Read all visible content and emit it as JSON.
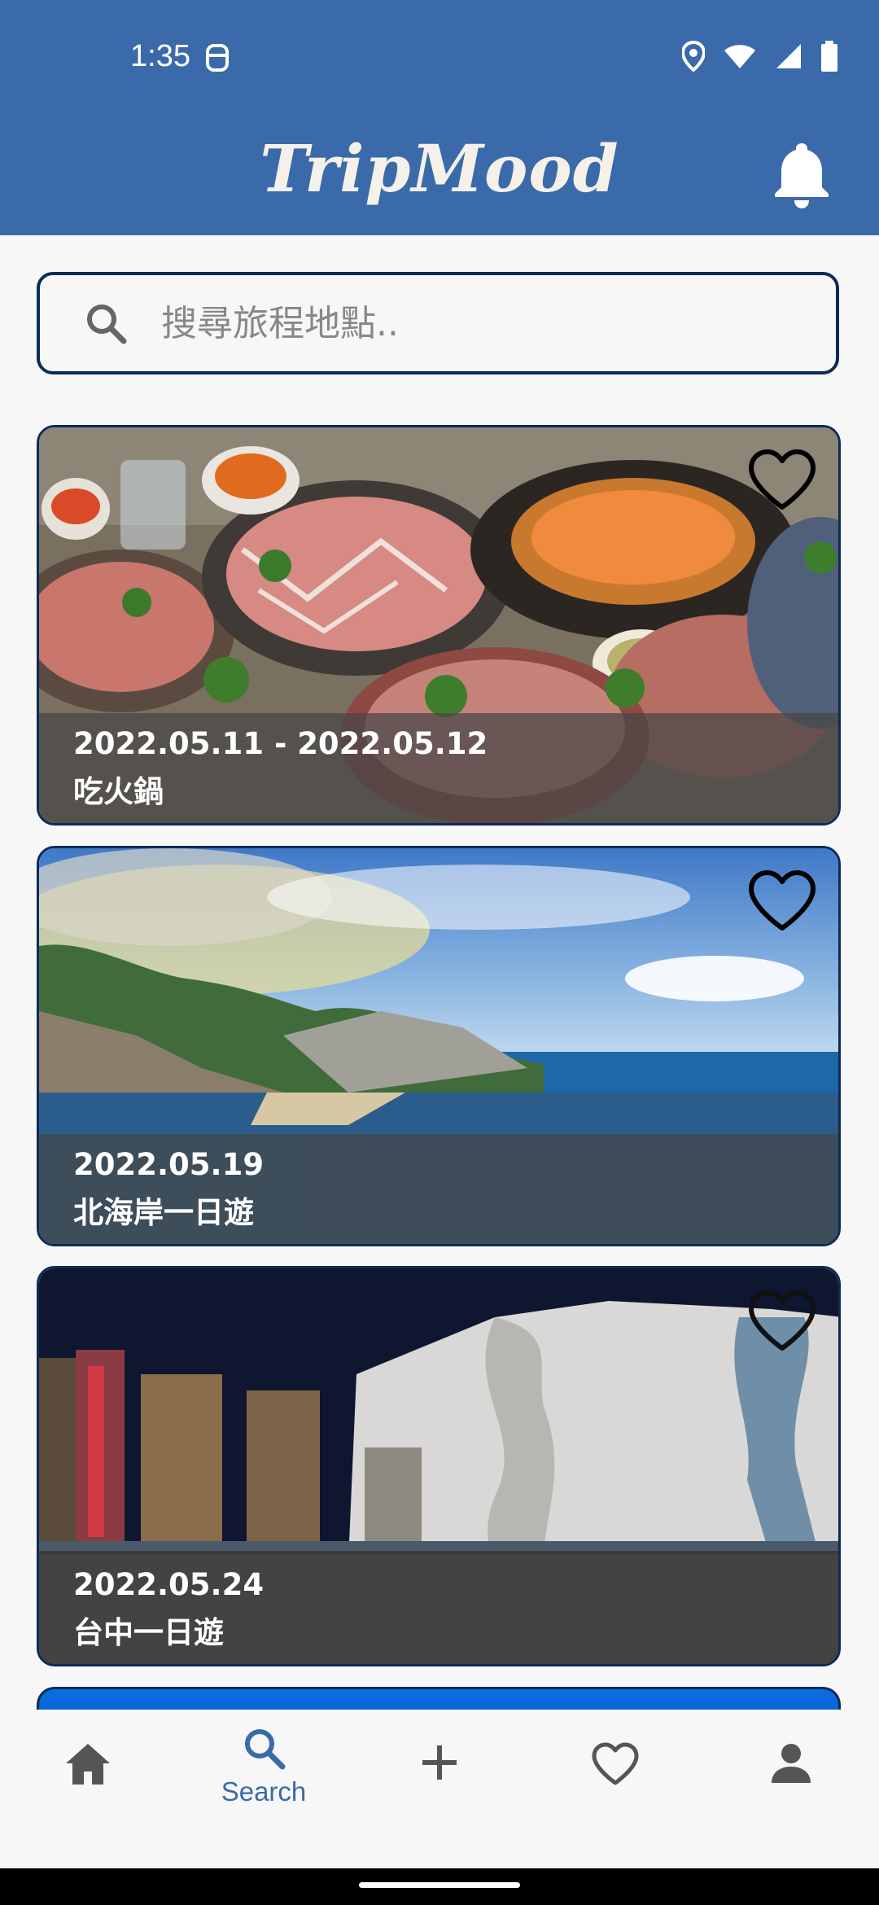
{
  "status": {
    "time": "1:35"
  },
  "header": {
    "title": "TripMood"
  },
  "search": {
    "placeholder": "搜尋旅程地點.."
  },
  "trips": [
    {
      "date": "2022.05.11 - 2022.05.12",
      "name": "吃火鍋"
    },
    {
      "date": "2022.05.19",
      "name": "北海岸一日遊"
    },
    {
      "date": "2022.05.24",
      "name": "台中一日遊"
    }
  ],
  "nav": {
    "search_label": "Search"
  },
  "colors": {
    "brand": "#3a6aaa",
    "border": "#0d2b55",
    "active": "#3a6aaa"
  },
  "icons": [
    "location-icon",
    "wifi-icon",
    "signal-icon",
    "battery-icon",
    "bell-icon",
    "search-icon",
    "heart-icon",
    "home-icon",
    "plus-icon",
    "person-icon"
  ]
}
